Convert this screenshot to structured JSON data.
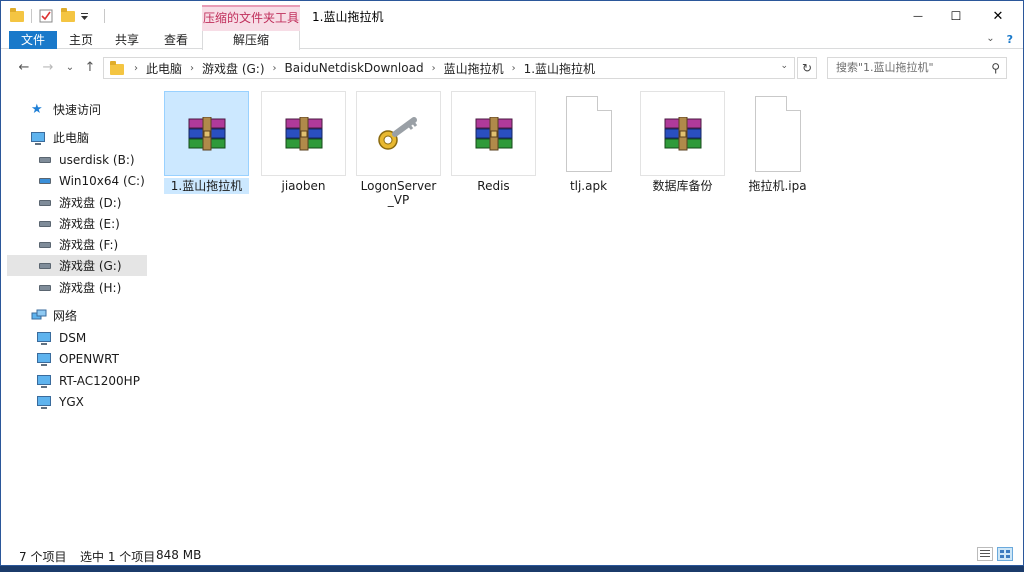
{
  "titlebar": {
    "context_tab_header": "压缩的文件夹工具",
    "window_title": "1.蓝山拖拉机",
    "minimize": "—",
    "maximize": "☐",
    "close": "✕"
  },
  "ribbon": {
    "tabs": [
      {
        "label": "文件"
      },
      {
        "label": "主页"
      },
      {
        "label": "共享"
      },
      {
        "label": "查看"
      },
      {
        "label": "解压缩"
      }
    ],
    "expand": "⌄",
    "help": "?"
  },
  "nav": {
    "back": "←",
    "forward": "→",
    "recent": "⌄",
    "up": "↑",
    "breadcrumb": [
      "此电脑",
      "游戏盘 (G:)",
      "BaiduNetdiskDownload",
      "蓝山拖拉机",
      "1.蓝山拖拉机"
    ],
    "refresh": "↻",
    "search_placeholder": "搜索\"1.蓝山拖拉机\""
  },
  "sidebar": {
    "items": [
      {
        "label": "快速访问",
        "icon": "star-icon"
      },
      {
        "label": "此电脑",
        "icon": "computer-icon"
      },
      {
        "label": "userdisk (B:)",
        "icon": "drive-icon"
      },
      {
        "label": "Win10x64 (C:)",
        "icon": "drive-icon"
      },
      {
        "label": "游戏盘 (D:)",
        "icon": "drive-icon"
      },
      {
        "label": "游戏盘 (E:)",
        "icon": "drive-icon"
      },
      {
        "label": "游戏盘 (F:)",
        "icon": "drive-icon"
      },
      {
        "label": "游戏盘 (G:)",
        "icon": "drive-icon",
        "selected": true
      },
      {
        "label": "游戏盘 (H:)",
        "icon": "drive-icon"
      },
      {
        "label": "网络",
        "icon": "network-icon"
      },
      {
        "label": "DSM",
        "icon": "monitor-icon"
      },
      {
        "label": "OPENWRT",
        "icon": "monitor-icon"
      },
      {
        "label": "RT-AC1200HP",
        "icon": "monitor-icon"
      },
      {
        "label": "YGX",
        "icon": "monitor-icon"
      }
    ]
  },
  "files": [
    {
      "name": "1.蓝山拖拉机",
      "icon": "archive-icon",
      "selected": true
    },
    {
      "name": "jiaoben",
      "icon": "archive-icon"
    },
    {
      "name": "LogonServer_VP",
      "icon": "key-icon"
    },
    {
      "name": "Redis",
      "icon": "archive-icon"
    },
    {
      "name": "tlj.apk",
      "icon": "document-icon"
    },
    {
      "name": "数据库备份",
      "icon": "archive-icon"
    },
    {
      "name": "拖拉机.ipa",
      "icon": "document-icon"
    }
  ],
  "status": {
    "count": "7 个项目",
    "selected": "选中 1 个项目",
    "size": "848 MB"
  }
}
